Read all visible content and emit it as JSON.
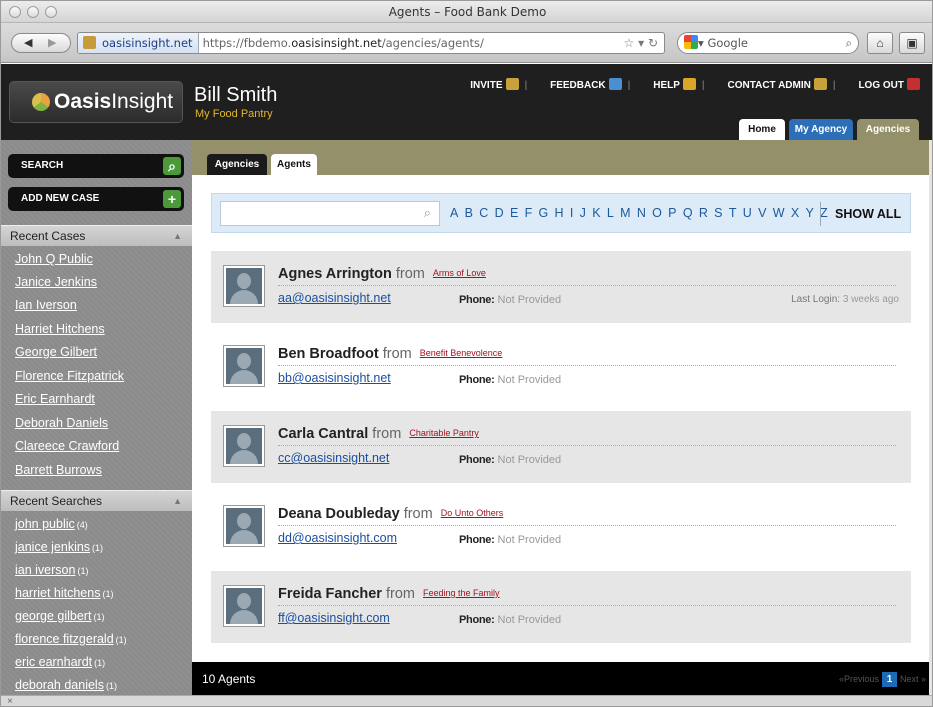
{
  "window": {
    "title": "Agents – Food Bank Demo"
  },
  "browser": {
    "site_badge": "oasisinsight.net",
    "url_prefix": "https://fbdemo.",
    "url_domain": "oasisinsight.net",
    "url_path": "/agencies/agents/",
    "search_engine": "Google",
    "status_close": "×"
  },
  "header": {
    "logo_bold": "Oasis",
    "logo_light": "Insight",
    "user_name": "Bill Smith",
    "org_name": "My Food Pantry",
    "links": [
      "INVITE",
      "FEEDBACK",
      "HELP",
      "CONTACT ADMIN",
      "LOG OUT"
    ],
    "tabs": [
      "Home",
      "My Agency",
      "Agencies"
    ]
  },
  "sidebar": {
    "search_label": "SEARCH",
    "add_case_label": "ADD NEW CASE",
    "recent_cases_title": "Recent Cases",
    "recent_cases": [
      "John Q Public",
      "Janice Jenkins",
      "Ian Iverson",
      "Harriet Hitchens",
      "George Gilbert",
      "Florence Fitzpatrick",
      "Eric Earnhardt",
      "Deborah Daniels",
      "Clareece Crawford",
      "Barrett Burrows"
    ],
    "recent_searches_title": "Recent Searches",
    "recent_searches": [
      {
        "term": "john public",
        "count": "(4)"
      },
      {
        "term": "janice jenkins",
        "count": "(1)"
      },
      {
        "term": "ian iverson",
        "count": "(1)"
      },
      {
        "term": "harriet hitchens",
        "count": "(1)"
      },
      {
        "term": "george gilbert",
        "count": "(1)"
      },
      {
        "term": "florence fitzgerald",
        "count": "(1)"
      },
      {
        "term": "eric earnhardt",
        "count": "(1)"
      },
      {
        "term": "deborah daniels",
        "count": "(1)"
      }
    ]
  },
  "content": {
    "tabs": [
      "Agencies",
      "Agents"
    ],
    "active_tab": "Agents",
    "letters": [
      "A",
      "B",
      "C",
      "D",
      "E",
      "F",
      "G",
      "H",
      "I",
      "J",
      "K",
      "L",
      "M",
      "N",
      "O",
      "P",
      "Q",
      "R",
      "S",
      "T",
      "U",
      "V",
      "W",
      "X",
      "Y",
      "Z"
    ],
    "show_all": "SHOW ALL",
    "from_word": "from",
    "phone_label": "Phone:",
    "agents": [
      {
        "name": "Agnes Arrington",
        "agency": "Arms of Love",
        "email": "aa@oasisinsight.net",
        "phone": "Not Provided",
        "last_login_label": "Last Login:",
        "last_login": "3 weeks ago"
      },
      {
        "name": "Ben Broadfoot",
        "agency": "Benefit Benevolence",
        "email": "bb@oasisinsight.net",
        "phone": "Not Provided",
        "last_login_label": "",
        "last_login": ""
      },
      {
        "name": "Carla Cantral",
        "agency": "Charitable Pantry",
        "email": "cc@oasisinsight.net",
        "phone": "Not Provided",
        "last_login_label": "",
        "last_login": ""
      },
      {
        "name": "Deana Doubleday",
        "agency": "Do Unto Others",
        "email": "dd@oasisinsight.com",
        "phone": "Not Provided",
        "last_login_label": "",
        "last_login": ""
      },
      {
        "name": "Freida Fancher",
        "agency": "Feeding the Family",
        "email": "ff@oasisinsight.com",
        "phone": "Not Provided",
        "last_login_label": "",
        "last_login": ""
      }
    ],
    "count_text": "10 Agents",
    "pager": {
      "prev": "«Previous",
      "current": "1",
      "next": "Next »"
    }
  },
  "colors": {
    "header_bg": "#1f1f1f",
    "tab_band": "#93906a",
    "accent_gold": "#e6b52e",
    "link_red": "#a1121e",
    "link_blue": "#1a4fa0",
    "row_gray": "#e6e6e6"
  }
}
